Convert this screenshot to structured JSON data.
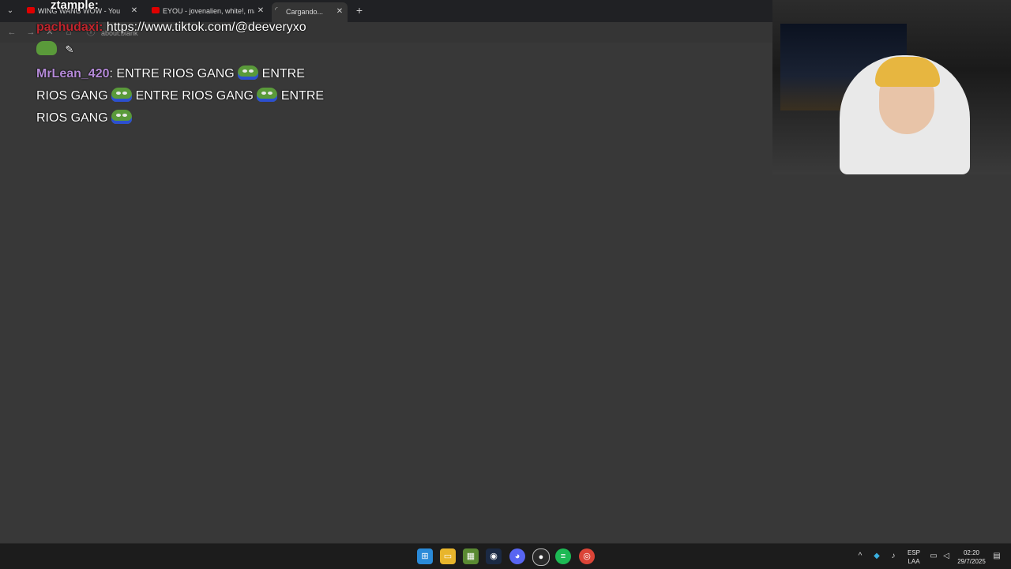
{
  "browser": {
    "tabs": [
      {
        "title": "WING WANG WOW - You",
        "close": "✕"
      },
      {
        "title": "EYOU - jovenalien, white!, mag",
        "close": "✕"
      },
      {
        "title": "Cargando...",
        "close": "✕"
      }
    ],
    "new_tab": "+",
    "tab_menu": "⌄",
    "address": "about:blank"
  },
  "chat": {
    "ztample_user": "ztample:",
    "pachu_user": "pachudaxi:",
    "pachu_message": " https://www.tiktok.com/@deeveryxo",
    "mrlean_user": "MrLean_420",
    "mrlean_sep": ":",
    "mrlean_line1_a": " ENTRE RIOS GANG ",
    "mrlean_line1_b": " ENTRE",
    "mrlean_line2_a": "RIOS GANG ",
    "mrlean_line2_b": " ENTRE RIOS GANG ",
    "mrlean_line2_c": " ENTRE",
    "mrlean_line3_a": "RIOS GANG "
  },
  "taskbar": {
    "apps": [
      "windows-start",
      "file-explorer",
      "minecraft",
      "steam",
      "discord",
      "obs",
      "spotify",
      "chrome"
    ],
    "lang_top": "ESP",
    "lang_bottom": "LAA",
    "time": "02:20",
    "date": "29/7/2025",
    "tray_chevron": "^"
  },
  "colors": {
    "background": "#383838",
    "mrlean_name": "#b58ad8",
    "pachu_name": "#c0262e",
    "taskbar": "#1c1c1c"
  }
}
